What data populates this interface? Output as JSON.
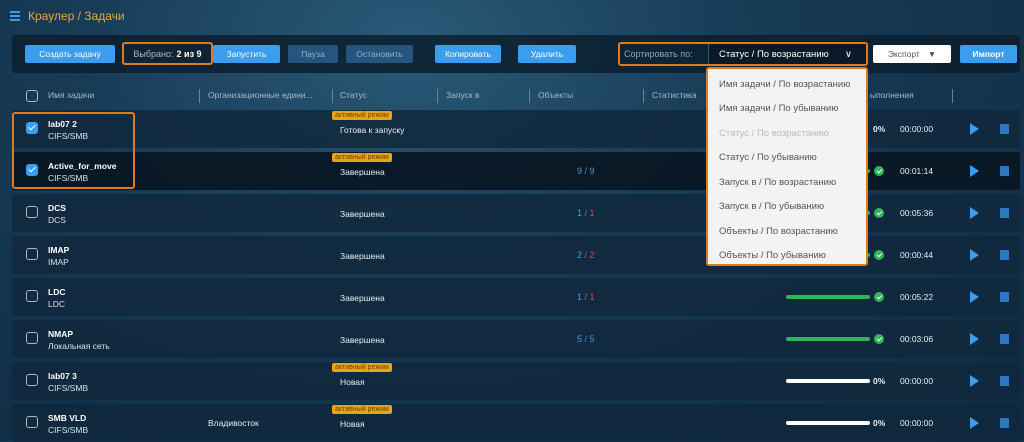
{
  "header": {
    "title": "Краулер / Задачи"
  },
  "toolbar": {
    "create": "Создать задачу",
    "selected_label": "Выбрано:",
    "selected_value": "2 из 9",
    "start": "Запустить",
    "pause": "Пауза",
    "stop": "Остановить",
    "copy": "Копировать",
    "delete": "Удалить",
    "sort_label": "Сортировать по:",
    "sort_value": "Статус / По возрастанию",
    "export": "Экспорт",
    "import": "Импорт"
  },
  "columns": {
    "name": "Имя задачи",
    "org": "Организационные едини...",
    "status": "Статус",
    "start_at": "Запуск в",
    "objects": "Объекты",
    "stats": "Статистика",
    "progress": "ыполнения"
  },
  "sort_options": [
    {
      "label": "Имя задачи / По возрастанию",
      "disabled": false
    },
    {
      "label": "Имя задачи / По убыванию",
      "disabled": false
    },
    {
      "label": "Статус / По возрастанию",
      "disabled": true
    },
    {
      "label": "Статус / По убыванию",
      "disabled": false
    },
    {
      "label": "Запуск в / По возрастанию",
      "disabled": false
    },
    {
      "label": "Запуск в / По убыванию",
      "disabled": false
    },
    {
      "label": "Объекты / По возрастанию",
      "disabled": false
    },
    {
      "label": "Объекты / По убыванию",
      "disabled": false
    }
  ],
  "badge_text": "активный режим",
  "colors": {
    "accent": "#3a9df0",
    "highlight": "#e07a1e",
    "success": "#2fb55a",
    "error": "#e04050",
    "title": "#e8a73a"
  },
  "rows": [
    {
      "name": "lab07 2",
      "type": "CIFS/SMB",
      "org": "",
      "status": "Готова к запуску",
      "badge": true,
      "checked": true,
      "obj_a": "",
      "obj_b": "",
      "progress": 0,
      "pct": "0%",
      "time": "00:00:00",
      "done": false
    },
    {
      "name": "Active_for_move",
      "type": "CIFS/SMB",
      "org": "",
      "status": "Завершена",
      "badge": true,
      "checked": true,
      "obj_a": "9",
      "obj_b": "9",
      "obj_b_error": false,
      "progress": 100,
      "pct": "",
      "time": "00:01:14",
      "done": true
    },
    {
      "name": "DCS",
      "type": "DCS",
      "org": "",
      "status": "Завершена",
      "badge": false,
      "checked": false,
      "obj_a": "1",
      "obj_b": "1",
      "obj_b_error": true,
      "progress": 100,
      "pct": "",
      "time": "00:05:36",
      "done": true
    },
    {
      "name": "IMAP",
      "type": "IMAP",
      "org": "",
      "status": "Завершена",
      "badge": false,
      "checked": false,
      "obj_a": "2",
      "obj_b": "2",
      "obj_b_error": true,
      "progress": 100,
      "pct": "",
      "time": "00:00:44",
      "done": true
    },
    {
      "name": "LDC",
      "type": "LDC",
      "org": "",
      "status": "Завершена",
      "badge": false,
      "checked": false,
      "obj_a": "1",
      "obj_b": "1",
      "obj_b_error": true,
      "progress": 100,
      "pct": "",
      "time": "00:05:22",
      "done": true
    },
    {
      "name": "NMAP",
      "type": "Локальная сеть",
      "org": "",
      "status": "Завершена",
      "badge": false,
      "checked": false,
      "obj_a": "5",
      "obj_b": "5",
      "obj_b_error": false,
      "progress": 100,
      "pct": "",
      "time": "00:03:06",
      "done": true
    },
    {
      "name": "lab07 3",
      "type": "CIFS/SMB",
      "org": "",
      "status": "Новая",
      "badge": true,
      "checked": false,
      "obj_a": "",
      "obj_b": "",
      "progress": 0,
      "pct": "0%",
      "time": "00:00:00",
      "done": false
    },
    {
      "name": "SMB VLD",
      "type": "CIFS/SMB",
      "org": "Владивосток",
      "status": "Новая",
      "badge": true,
      "checked": false,
      "obj_a": "",
      "obj_b": "",
      "progress": 0,
      "pct": "0%",
      "time": "00:00:00",
      "done": false
    }
  ]
}
